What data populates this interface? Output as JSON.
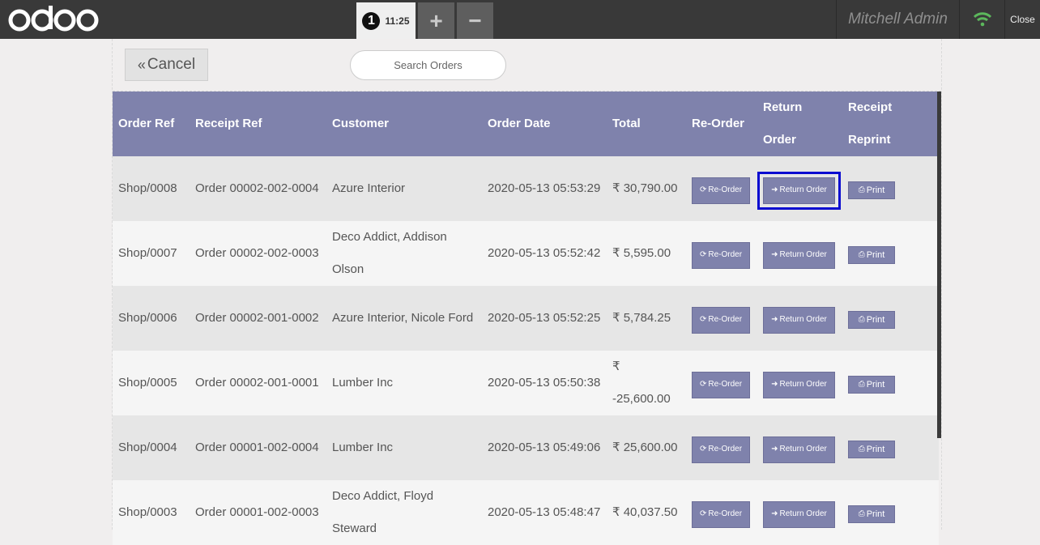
{
  "topbar": {
    "order_number": "1",
    "order_time": "11:25",
    "add_order_label": "+",
    "remove_order_label": "−",
    "user_name": "Mitchell Admin",
    "close_label": "Close"
  },
  "screen": {
    "cancel_label": "Cancel",
    "search_placeholder": "Search Orders"
  },
  "table": {
    "headers": {
      "order_ref": "Order Ref",
      "receipt_ref": "Receipt Ref",
      "customer": "Customer",
      "order_date": "Order Date",
      "total": "Total",
      "reorder": "Re-Order",
      "return_order": "Return Order",
      "receipt_reprint": "Receipt Reprint"
    },
    "rows": [
      {
        "order_ref": "Shop/0008",
        "receipt_ref": "Order 00002-002-0004",
        "customer": "Azure Interior",
        "order_date": "2020-05-13 05:53:29",
        "total": "₹ 30,790.00"
      },
      {
        "order_ref": "Shop/0007",
        "receipt_ref": "Order 00002-002-0003",
        "customer": "Deco Addict, Addison Olson",
        "order_date": "2020-05-13 05:52:42",
        "total": "₹ 5,595.00"
      },
      {
        "order_ref": "Shop/0006",
        "receipt_ref": "Order 00002-001-0002",
        "customer": "Azure Interior, Nicole Ford",
        "order_date": "2020-05-13 05:52:25",
        "total": "₹ 5,784.25"
      },
      {
        "order_ref": "Shop/0005",
        "receipt_ref": "Order 00002-001-0001",
        "customer": "Lumber Inc",
        "order_date": "2020-05-13 05:50:38",
        "total": "₹ -25,600.00"
      },
      {
        "order_ref": "Shop/0004",
        "receipt_ref": "Order 00001-002-0004",
        "customer": "Lumber Inc",
        "order_date": "2020-05-13 05:49:06",
        "total": "₹ 25,600.00"
      },
      {
        "order_ref": "Shop/0003",
        "receipt_ref": "Order 00001-002-0003",
        "customer": "Deco Addict, Floyd Steward",
        "order_date": "2020-05-13 05:48:47",
        "total": "₹ 40,037.50"
      }
    ],
    "buttons": {
      "reorder": "Re-Order",
      "return": "Return Order",
      "print": "Print"
    }
  },
  "colors": {
    "accent": "#7f82ac",
    "topbar": "#393939",
    "focus_outline": "#0a0ad0",
    "wifi": "#5cb85c"
  }
}
